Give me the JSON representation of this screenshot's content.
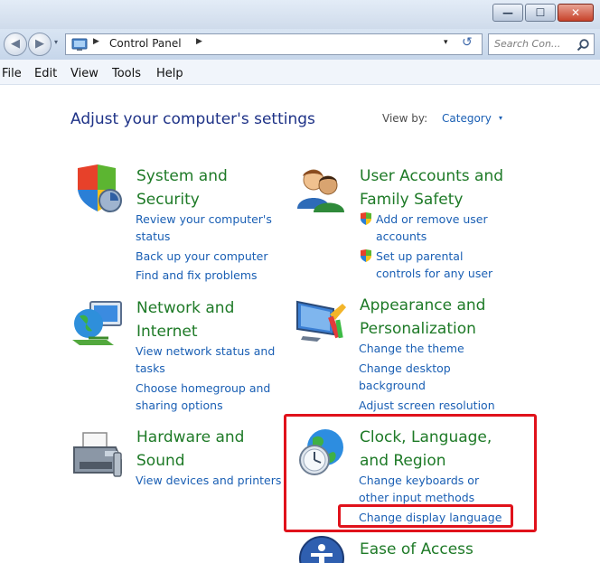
{
  "window": {
    "minimize_glyph": "—",
    "maximize_glyph": "☐",
    "close_glyph": "✕"
  },
  "address": {
    "back_glyph": "◀",
    "forward_glyph": "▶",
    "dropdown_glyph": "▾",
    "crumb_separator": "▶",
    "location": "Control Panel",
    "refresh_glyph": "↺",
    "search_placeholder": "Search Con..."
  },
  "menu": {
    "items": [
      "File",
      "Edit",
      "View",
      "Tools",
      "Help"
    ]
  },
  "content": {
    "heading": "Adjust your computer's settings",
    "view_by_label": "View by:",
    "view_by_value": "Category",
    "caret": "▾"
  },
  "categories": {
    "system": {
      "title_line1": "System and",
      "title_line2": "Security",
      "links": [
        "Review your computer's",
        "status",
        "Back up your computer",
        "Find and fix problems"
      ],
      "icon": "shield-icon"
    },
    "network": {
      "title_line1": "Network and",
      "title_line2": "Internet",
      "links": [
        "View network status and",
        "tasks",
        "Choose homegroup and",
        "sharing options"
      ],
      "icon": "network-globe-icon"
    },
    "hardware": {
      "title_line1": "Hardware and",
      "title_line2": "Sound",
      "links": [
        "View devices and printers"
      ],
      "icon": "printer-icon"
    },
    "users": {
      "title_line1": "User Accounts and",
      "title_line2": "Family Safety",
      "links": [
        "Add or remove user",
        "accounts",
        "Set up parental",
        "controls for any user"
      ],
      "icon": "users-icon"
    },
    "appearance": {
      "title_line1": "Appearance and",
      "title_line2": "Personalization",
      "links": [
        "Change the theme",
        "Change desktop",
        "background",
        "Adjust screen resolution"
      ],
      "icon": "monitor-paint-icon"
    },
    "clock": {
      "title_line1": "Clock, Language,",
      "title_line2": "and Region",
      "links": [
        "Change keyboards or",
        "other input methods",
        "Change display language"
      ],
      "icon": "globe-clock-icon"
    },
    "ease": {
      "title": "Ease of Access",
      "icon": "ease-of-access-icon"
    }
  },
  "colors": {
    "category_title": "#1e7a27",
    "link": "#1a5fb4",
    "heading": "#1e3287",
    "highlight": "#e0121b"
  }
}
